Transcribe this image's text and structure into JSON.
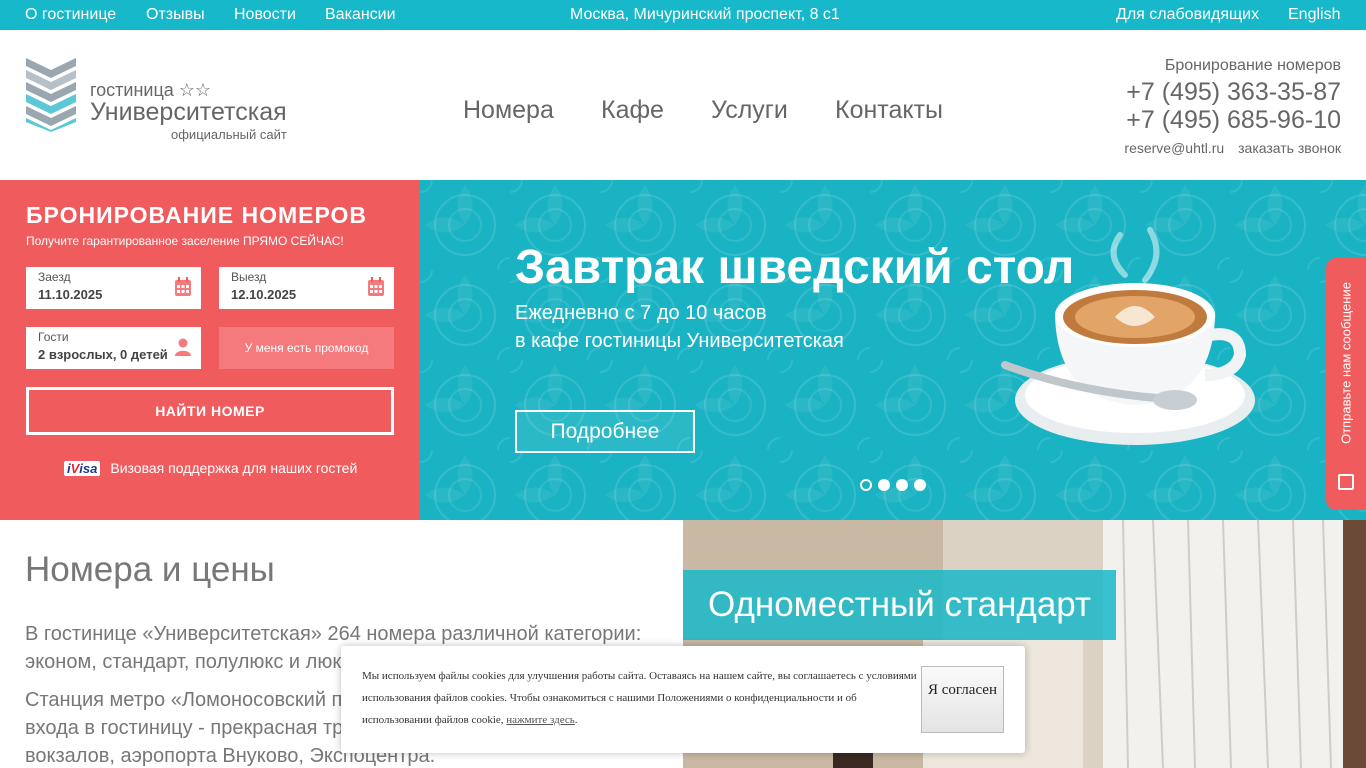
{
  "topbar": {
    "links_left": [
      "О гостинице",
      "Отзывы",
      "Новости",
      "Вакансии"
    ],
    "address": "Москва, Мичуринский проспект, 8 с1",
    "accessibility": "Для слабовидящих",
    "language": "English"
  },
  "header": {
    "logo_line1": "гостиница ☆☆",
    "logo_line2": "Университетская",
    "logo_line3": "официальный сайт",
    "nav": [
      "Номера",
      "Кафе",
      "Услуги",
      "Контакты"
    ],
    "booking_label": "Бронирование номеров",
    "phone1": "+7 (495) 363-35-87",
    "phone2": "+7 (495) 685-96-10",
    "email": "reserve@uhtl.ru",
    "callback": "заказать звонок"
  },
  "booking": {
    "title": "БРОНИРОВАНИЕ НОМЕРОВ",
    "subtitle": "Получите гарантированное заселение ПРЯМО СЕЙЧАС!",
    "checkin_label": "Заезд",
    "checkin_value": "11.10.2025",
    "checkout_label": "Выезд",
    "checkout_value": "12.10.2025",
    "guests_label": "Гости",
    "guests_value": "2 взрослых, 0 детей",
    "promo": "У меня есть промокод",
    "find": "НАЙТИ НОМЕР",
    "visa_logo_i": "i",
    "visa_logo_v": "V",
    "visa_logo_rest": "isa",
    "visa_text": "Визовая поддержка для наших гостей"
  },
  "hero": {
    "title": "Завтрак шведский стол",
    "line1": "Ежедневно с 7 до 10 часов",
    "line2": "в кафе гостиницы Университетская",
    "button": "Подробнее",
    "slides": 4,
    "active_slide": 1
  },
  "side_tab": {
    "label": "Отправьте нам сообщение"
  },
  "rooms": {
    "title": "Номера и цены",
    "p1": "В гостинице «Университетская» 264 номера различной категории: эконом, стандарт, полулюкс и люкс.",
    "p2": "Станция метро «Ломоносовский проспект» в 5 минутах ходьбы от входа в гостиницу - прекрасная транспортная доступность вокзалов, аэропорта Внуково, Экспоцентра."
  },
  "room_card": {
    "title": "Одноместный стандарт"
  },
  "cookie": {
    "text": "Мы используем файлы cookies для улучшения работы сайта. Оставаясь на нашем сайте, вы соглашаетесь с условиями использования файлов cookies. Чтобы ознакомиться с нашими Положениями о конфиденциальности и об использовании файлов cookie, ",
    "link": "нажмите здесь",
    "after": ".",
    "agree": "Я согласен"
  },
  "colors": {
    "teal": "#17b8c9",
    "coral": "#f05b5e"
  }
}
